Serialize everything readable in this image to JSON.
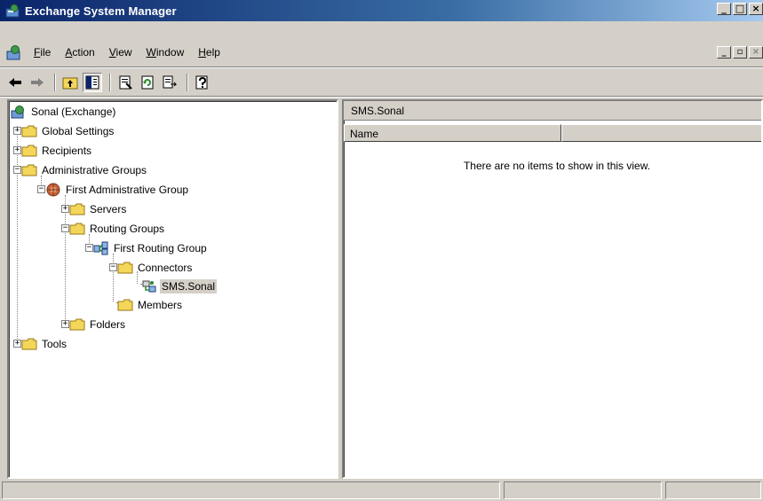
{
  "window": {
    "title": "Exchange System Manager",
    "caption_buttons": [
      "_",
      "□",
      "×"
    ]
  },
  "menu": {
    "items": [
      {
        "label": "File",
        "accel": "F"
      },
      {
        "label": "Action",
        "accel": "A"
      },
      {
        "label": "View",
        "accel": "V"
      },
      {
        "label": "Window",
        "accel": "W"
      },
      {
        "label": "Help",
        "accel": "H"
      }
    ],
    "mdi_buttons": [
      "_",
      "▫",
      "×"
    ]
  },
  "toolbar": {
    "icons": [
      "back-arrow-icon",
      "forward-arrow-icon",
      "up-level-icon",
      "show-hide-tree-icon",
      "properties-icon",
      "refresh-icon",
      "export-list-icon",
      "help-icon"
    ]
  },
  "tree": {
    "root": "Sonal (Exchange)",
    "global_settings": "Global Settings",
    "recipients": "Recipients",
    "administrative_groups": "Administrative Groups",
    "first_administrative_group": "First Administrative Group",
    "servers": "Servers",
    "routing_groups": "Routing Groups",
    "first_routing_group": "First Routing Group",
    "connectors": "Connectors",
    "sms_sonal": "SMS.Sonal",
    "members": "Members",
    "folders": "Folders",
    "tools": "Tools"
  },
  "details": {
    "header": "SMS.Sonal",
    "columns": [
      "Name",
      ""
    ],
    "empty_message": "There are no items to show in this view."
  },
  "colors": {
    "title_active": "#0a246a",
    "title_gradient_end": "#a6caf0",
    "chrome": "#d4d0c8",
    "folder": "#f4d65a"
  }
}
